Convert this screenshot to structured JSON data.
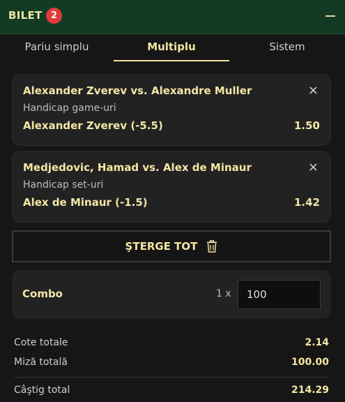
{
  "header": {
    "title": "BILET",
    "badge_count": "2"
  },
  "tabs": [
    {
      "label": "Pariu simplu",
      "active": false
    },
    {
      "label": "Multiplu",
      "active": true
    },
    {
      "label": "Sistem",
      "active": false
    }
  ],
  "bets": [
    {
      "match": "Alexander Zverev vs. Alexandre Muller",
      "market": "Handicap game-uri",
      "selection": "Alexander Zverev (-5.5)",
      "odds": "1.50"
    },
    {
      "match": "Medjedovic, Hamad vs. Alex de Minaur",
      "market": "Handicap set-uri",
      "selection": "Alex de Minaur (-1.5)",
      "odds": "1.42"
    }
  ],
  "close_symbol": "×",
  "clear_button": {
    "label": "ŞTERGE TOT"
  },
  "combo": {
    "label": "Combo",
    "multiplier": "1 x",
    "stake_value": "100"
  },
  "summary": {
    "total_odds_label": "Cote totale",
    "total_odds_value": "2.14",
    "total_stake_label": "Miză totală",
    "total_stake_value": "100.00",
    "total_win_label": "Câştig total",
    "total_win_value": "214.29"
  },
  "colors": {
    "header_bg": "#133a24",
    "accent_text": "#f3e6a4",
    "badge": "#e03a3a",
    "panel": "#222222",
    "background": "#161616"
  },
  "icons": {
    "collapse": "minus-icon",
    "close": "close-icon",
    "clear": "trash-icon"
  }
}
